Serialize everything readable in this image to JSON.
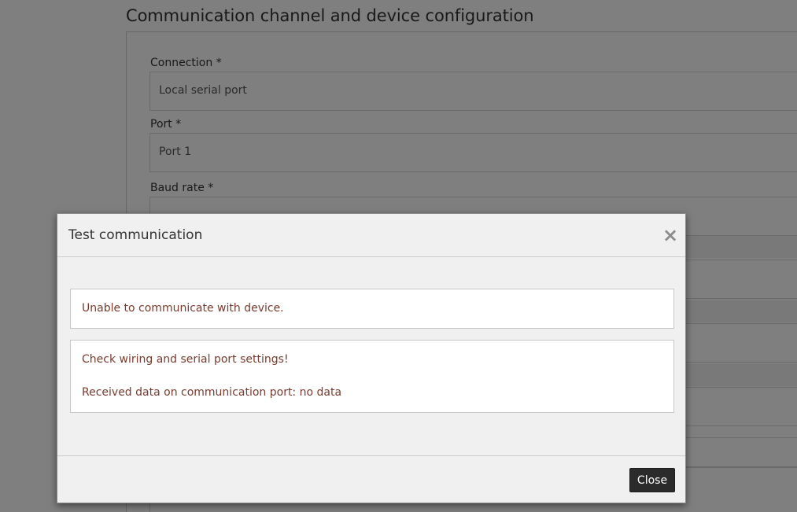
{
  "page": {
    "title": "Communication channel and device configuration"
  },
  "form": {
    "connection": {
      "label": "Connection *",
      "value": "Local serial port"
    },
    "port": {
      "label": "Port *",
      "value": "Port 1"
    },
    "baud_rate": {
      "label": "Baud rate *"
    }
  },
  "modal": {
    "title": "Test communication",
    "close_icon": "×",
    "alerts": {
      "primary": "Unable to communicate with device.",
      "hint": "Check wiring and serial port settings!",
      "received": "Received data on communication port: no data"
    },
    "footer": {
      "close_label": "Close"
    }
  },
  "colors": {
    "overlay": "rgba(0,0,0,0.5)",
    "alert_text": "#7a3b2e",
    "button_bg": "#2b2b2b"
  },
  "icons": {
    "close": "close-icon"
  }
}
